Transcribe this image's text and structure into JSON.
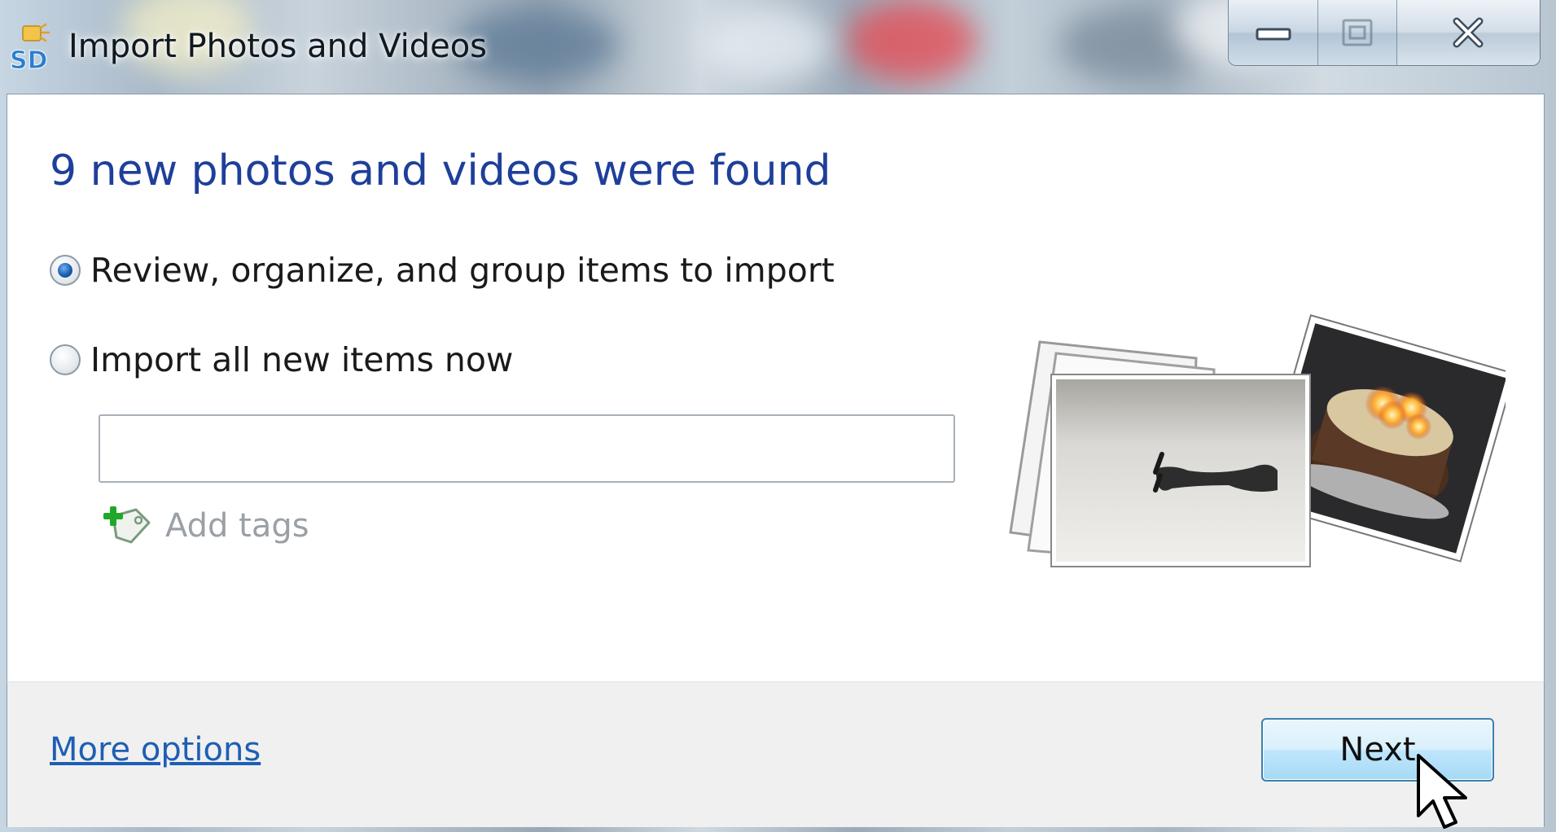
{
  "window": {
    "title": "Import Photos and Videos",
    "app_icon_label": "SD"
  },
  "caption_buttons": {
    "minimize_icon": "minimize-icon",
    "maximize_icon": "maximize-icon",
    "close_icon": "close-icon"
  },
  "main": {
    "heading": "9 new photos and videos were found",
    "options": [
      {
        "label": "Review, organize, and group items to import",
        "checked": true
      },
      {
        "label": "Import all new items now",
        "checked": false
      }
    ],
    "tags_input": {
      "value": "",
      "placeholder": ""
    },
    "add_tags_label": "Add tags"
  },
  "footer": {
    "more_options_label": "More options",
    "next_label": "Next"
  },
  "colors": {
    "heading": "#1e3f9a",
    "link": "#1d5fb4",
    "footer_bg": "#f0f0f0"
  }
}
